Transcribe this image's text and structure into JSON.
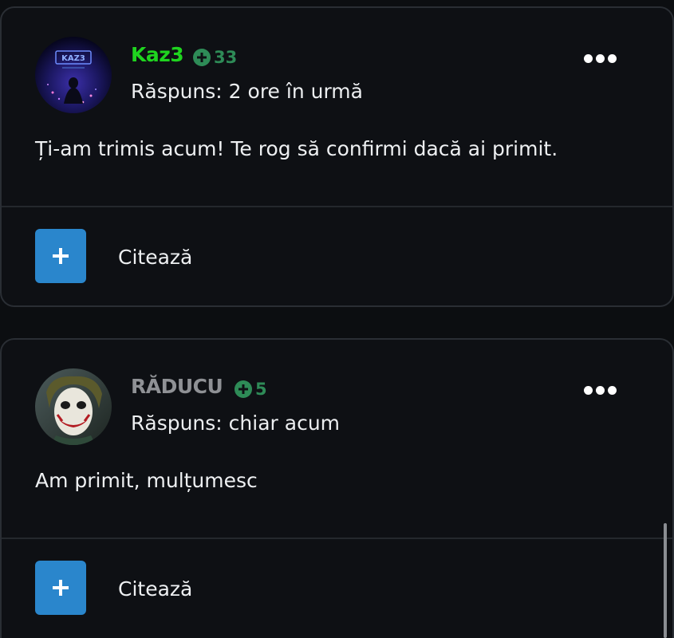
{
  "posts": [
    {
      "author": "Kaz3",
      "author_color": "#1fd41f",
      "reputation": "33",
      "meta": "Răspuns: 2 ore în urmă",
      "content": "Ți-am trimis acum! Te rog să confirmi dacă ai primit.",
      "quote_label": "Citează",
      "avatar_text": "KAZ3"
    },
    {
      "author": "RĂDUCU",
      "author_color": "#8f9195",
      "reputation": "5",
      "meta": "Răspuns: chiar acum",
      "content": "Am primit, mulțumesc",
      "quote_label": "Citează"
    }
  ],
  "colors": {
    "background": "#0c0e11",
    "reputation": "#2e8b57",
    "quote_button": "#2a86cc"
  },
  "icons": {
    "reputation": "plus-circle-icon",
    "more": "more-horizontal-icon",
    "quote": "plus-icon"
  }
}
